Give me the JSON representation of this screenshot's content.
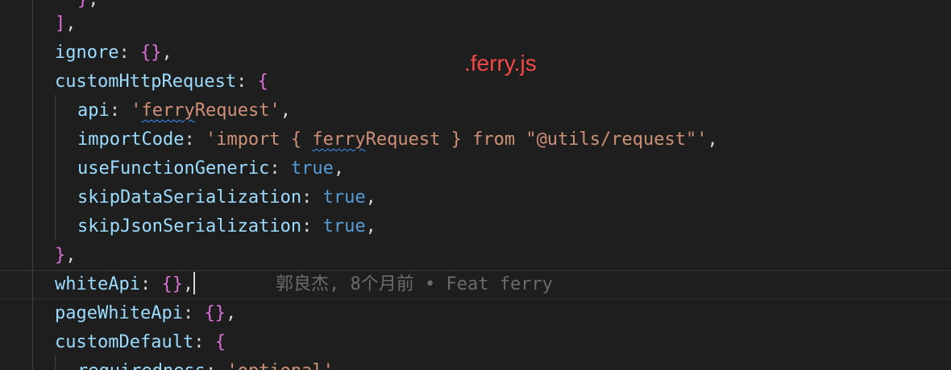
{
  "annotation": {
    "filename": ".ferry.js",
    "color": "#f44747"
  },
  "lines": [
    {
      "id": "partial-top",
      "tokens": [
        "}",
        ","
      ]
    },
    {
      "id": "array-close",
      "tokens": [
        "]",
        ","
      ]
    },
    {
      "id": "ignore",
      "key": "ignore",
      "colon": ":",
      "value": "{}",
      "end": ","
    },
    {
      "id": "customHttpRequest",
      "key": "customHttpRequest",
      "colon": ":",
      "open": "{"
    },
    {
      "id": "api",
      "key": "api",
      "colon": ":",
      "str_open": "'",
      "str_squiggle": "ferry",
      "str_rest": "Request'",
      "end": ","
    },
    {
      "id": "importCode",
      "key": "importCode",
      "colon": ":",
      "str_part1": "'import { ",
      "str_squiggle": "ferry",
      "str_part2": "Request } from \"@utils/request\"'",
      "end": ","
    },
    {
      "id": "useFunctionGeneric",
      "key": "useFunctionGeneric",
      "colon": ":",
      "value": "true",
      "end": ","
    },
    {
      "id": "skipDataSerialization",
      "key": "skipDataSerialization",
      "colon": ":",
      "value": "true",
      "end": ","
    },
    {
      "id": "skipJsonSerialization",
      "key": "skipJsonSerialization",
      "colon": ":",
      "value": "true",
      "end": ","
    },
    {
      "id": "customHttpRequest-close",
      "close": "}",
      "end": ","
    },
    {
      "id": "whiteApi",
      "key": "whiteApi",
      "colon": ":",
      "value": "{}",
      "end": ","
    },
    {
      "id": "pageWhiteApi",
      "key": "pageWhiteApi",
      "colon": ":",
      "value": "{}",
      "end": ","
    },
    {
      "id": "customDefault",
      "key": "customDefault",
      "colon": ":",
      "open": "{"
    },
    {
      "id": "requiredness-partial",
      "key": "requiredness",
      "colon": ":",
      "str": "'optional'",
      "end": ","
    }
  ],
  "blame": {
    "text": "郭良杰, 8个月前 • Feat ferry"
  },
  "colors": {
    "background": "#1e1e1e",
    "property": "#9cdcfe",
    "string": "#ce9178",
    "boolean": "#569cd6",
    "brace": "#da70d6",
    "blame": "#6b6b6b"
  }
}
